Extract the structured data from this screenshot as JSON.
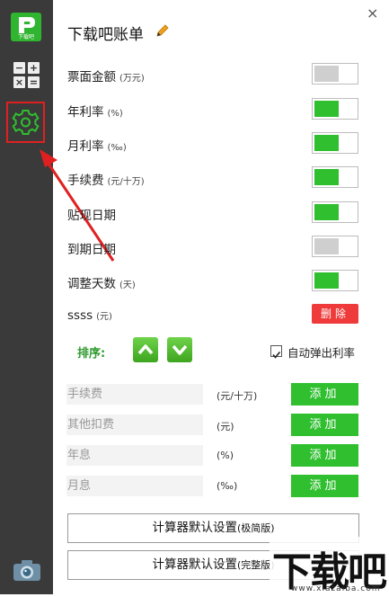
{
  "sidebar": {
    "logo_text": "下载吧",
    "calc_keys": [
      "−",
      "+",
      "×",
      "="
    ],
    "icons": [
      "app-logo-icon",
      "calculator-icon",
      "gear-icon",
      "camera-icon"
    ]
  },
  "header": {
    "title": "下载吧账单",
    "close": "×"
  },
  "settings": [
    {
      "label": "票面金额",
      "unit": "(万元)",
      "on": false
    },
    {
      "label": "年利率",
      "unit": "(%)",
      "on": true
    },
    {
      "label": "月利率",
      "unit": "(‰)",
      "on": true
    },
    {
      "label": "手续费",
      "unit": "(元/十万)",
      "on": true
    },
    {
      "label": "贴现日期",
      "unit": "",
      "on": true
    },
    {
      "label": "到期日期",
      "unit": "",
      "on": false
    },
    {
      "label": "调整天数",
      "unit": "(天)",
      "on": true
    }
  ],
  "custom_row": {
    "label": "ssss",
    "unit": "(元)",
    "delete_label": "删除"
  },
  "sort": {
    "label": "排序:",
    "auto_popup_label": "自动弹出利率",
    "auto_popup_checked": true
  },
  "add_fields": [
    {
      "placeholder": "手续费",
      "unit": "(元/十万)",
      "button": "添加"
    },
    {
      "placeholder": "其他扣费",
      "unit": "(元)",
      "button": "添加"
    },
    {
      "placeholder": "年息",
      "unit": "(%)",
      "button": "添加"
    },
    {
      "placeholder": "月息",
      "unit": "(‰)",
      "button": "添加"
    }
  ],
  "default_buttons": [
    {
      "main": "计算器默认设置",
      "sub": "(极简版)"
    },
    {
      "main": "计算器默认设置",
      "sub": "(完整版)"
    }
  ],
  "watermark": {
    "text": "下载吧",
    "url": "www.xiazaiba.com"
  },
  "colors": {
    "sidebar": "#3a3a3a",
    "accent_green": "#2fbf2f",
    "delete_red": "#ee3a3a",
    "highlight_red": "#e02020"
  }
}
